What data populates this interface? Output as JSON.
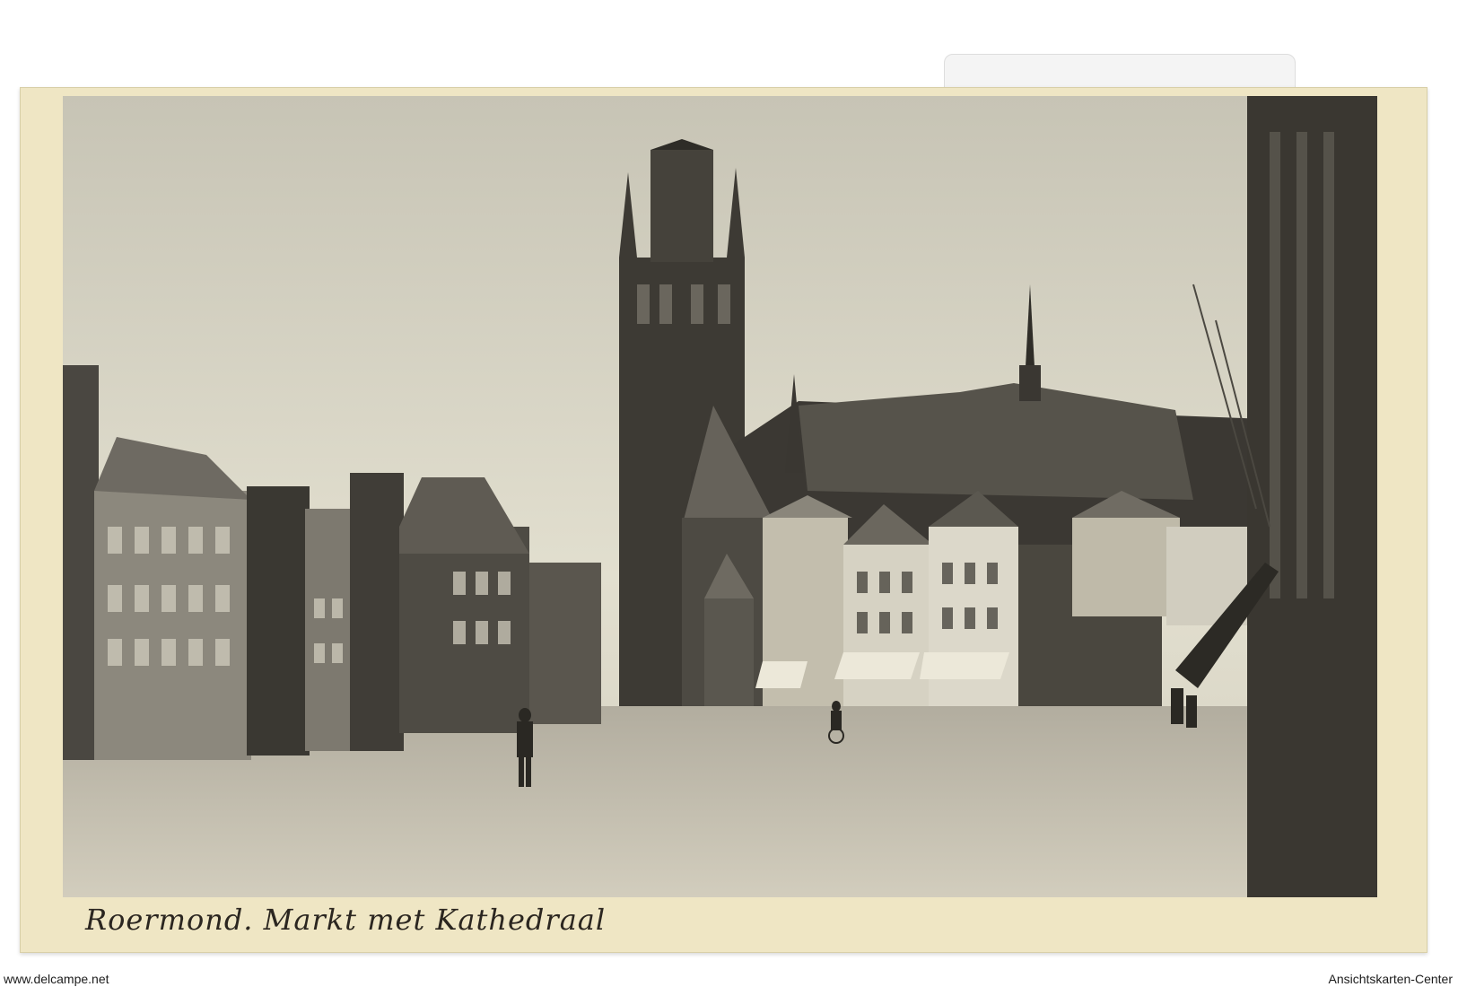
{
  "postcard": {
    "caption": "Roermond. Markt met Kathedraal"
  },
  "watermarks": {
    "left": "www.delcampe.net",
    "right": "Ansichtskarten-Center"
  },
  "colors": {
    "card": "#efe6c4",
    "sky": "#d8d5c6",
    "buildings": "#3e3c37"
  }
}
